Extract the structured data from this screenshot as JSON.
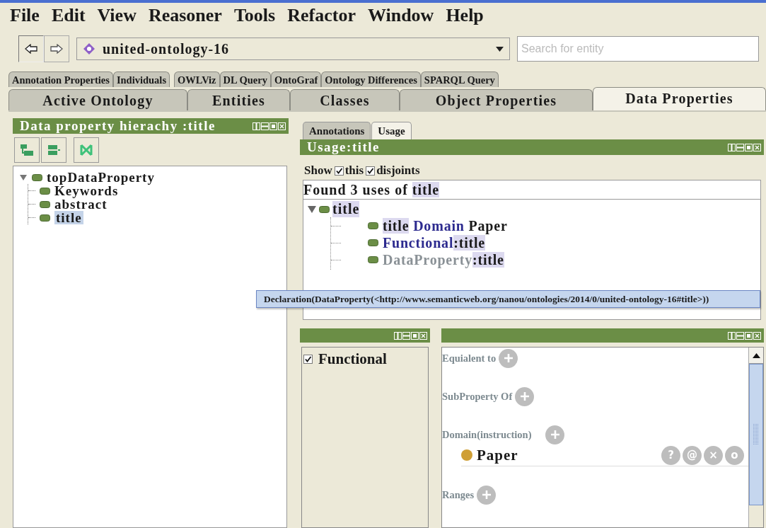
{
  "menu": [
    "File",
    "Edit",
    "View",
    "Reasoner",
    "Tools",
    "Refactor",
    "Window",
    "Help"
  ],
  "ontology_selector": {
    "value": "united-ontology-16"
  },
  "search": {
    "placeholder": "Search for entity"
  },
  "tabs_row_1": [
    {
      "label": "Annotation Properties",
      "selected": false
    },
    {
      "label": "Individuals",
      "selected": false
    },
    {
      "label": "OWLViz",
      "selected": false
    },
    {
      "label": "DL Query",
      "selected": false
    },
    {
      "label": "OntoGraf",
      "selected": false
    },
    {
      "label": "Ontology Differences",
      "selected": false
    },
    {
      "label": "SPARQL Query",
      "selected": false
    }
  ],
  "tabs_row_2": [
    {
      "label": "Active  Ontology",
      "selected": false
    },
    {
      "label": "Entities",
      "selected": false
    },
    {
      "label": "Classes",
      "selected": false
    },
    {
      "label": "Object Properties",
      "selected": false
    },
    {
      "label": "Data Properties",
      "selected": true
    }
  ],
  "hierarchy_view": {
    "title": "Data property hierachy :title",
    "tree": [
      {
        "label": "topDataProperty",
        "expanded": true,
        "selected": false,
        "children": [
          {
            "label": "Keywords",
            "selected": false
          },
          {
            "label": "abstract",
            "selected": false
          },
          {
            "label": "title",
            "selected": true
          }
        ]
      }
    ]
  },
  "usage_tabs": [
    {
      "label": "Annotations",
      "selected": false
    },
    {
      "label": "Usage",
      "selected": true
    }
  ],
  "usage_view": {
    "title": "Usage:title",
    "show_label": "Show",
    "options": [
      {
        "label": "this",
        "checked": true
      },
      {
        "label": "disjoints",
        "checked": true
      }
    ],
    "summary": "Found 3 uses of",
    "summary_entity": "title",
    "tree": {
      "label": "title",
      "expanded": true,
      "uses": [
        {
          "parts": [
            {
              "text": "title",
              "kind": "entity"
            },
            {
              "text": "Domain",
              "kind": "keyword"
            },
            {
              "text": "Paper",
              "kind": "plain"
            }
          ]
        },
        {
          "parts": [
            {
              "text": "Functional",
              "kind": "keyword"
            },
            {
              "text": ":title",
              "kind": "entity"
            }
          ]
        },
        {
          "parts": [
            {
              "text": "DataProperty",
              "kind": "muted"
            },
            {
              "text": ":title",
              "kind": "entity"
            }
          ]
        }
      ]
    }
  },
  "tooltip": "Declaration(DataProperty(<http://www.semanticweb.org/nanou/ontologies/2014/0/united-ontology-16#title>))",
  "characteristics_view": {
    "items": [
      {
        "label": "Functional",
        "checked": true
      }
    ]
  },
  "description_view": {
    "sections": [
      {
        "label": "Equialent to"
      },
      {
        "label": "SubProperty Of"
      },
      {
        "label": "Domain(instruction)",
        "items": [
          {
            "label": "Paper",
            "actions": [
              "?",
              "@",
              "×",
              "o"
            ]
          }
        ]
      },
      {
        "label": "Ranges"
      }
    ]
  }
}
